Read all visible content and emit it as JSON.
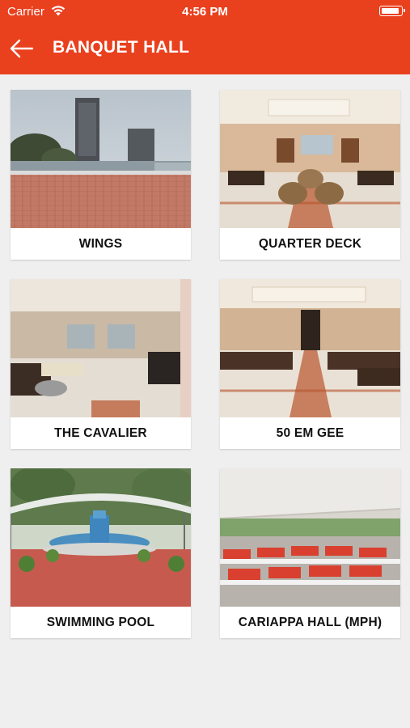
{
  "status_bar": {
    "carrier": "Carrier",
    "time": "4:56 PM",
    "wifi_icon": "wifi-icon",
    "battery_icon": "battery-icon"
  },
  "header": {
    "title": "BANQUET HALL",
    "back_icon": "arrow-left-icon",
    "background_color": "#e9401e",
    "text_color": "#ffffff"
  },
  "halls": [
    {
      "name": "WINGS"
    },
    {
      "name": "QUARTER DECK"
    },
    {
      "name": "THE CAVALIER"
    },
    {
      "name": "50 EM GEE"
    },
    {
      "name": "SWIMMING POOL"
    },
    {
      "name": "CARIAPPA HALL (MPH)"
    }
  ],
  "colors": {
    "page_background": "#efefef",
    "card_background": "#ffffff"
  }
}
